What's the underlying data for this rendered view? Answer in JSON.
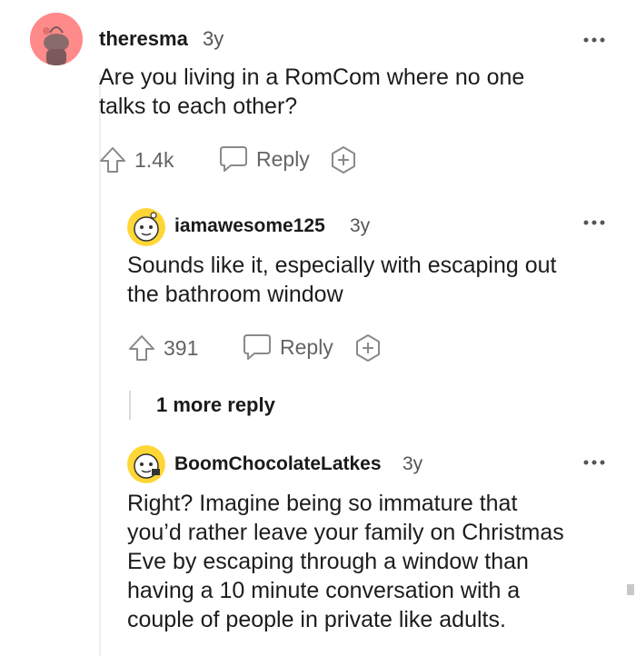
{
  "comments": [
    {
      "username": "theresma",
      "age": "3y",
      "text": "Are you living in a RomCom where no one\ntalks to each other?",
      "upvotes": "1.4k",
      "reply_label": "Reply",
      "more_icon": "more-dots-icon",
      "avatar_color": "#ff8a8a"
    },
    {
      "username": "iamawesome125",
      "age": "3y",
      "text": "Sounds like it, especially with escaping out\nthe bathroom window",
      "upvotes": "391",
      "reply_label": "Reply",
      "more_icon": "more-dots-icon",
      "avatar_color": "#ffd635"
    },
    {
      "username": "BoomChocolateLatkes",
      "age": "3y",
      "text": "Right? Imagine being so immature that\nyou’d rather leave your family on Christmas\nEve by escaping through a window than\nhaving a 10 minute conversation with a\ncouple of people in private like adults.",
      "more_icon": "more-dots-icon",
      "avatar_color": "#ffd635"
    }
  ],
  "more_replies_label": "1 more reply",
  "colors": {
    "text": "#1a1a1b",
    "muted": "#636466",
    "thread_line": "#edeff1"
  }
}
